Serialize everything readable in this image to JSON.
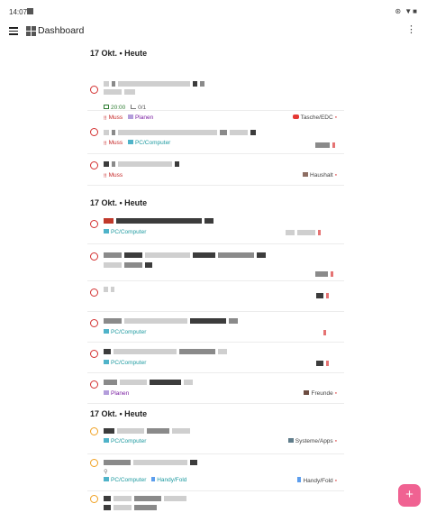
{
  "status_bar": {
    "time": "14:07",
    "icons": "⊛ ▼■"
  },
  "app_bar": {
    "title": "Dashboard",
    "more": "⋮"
  },
  "sections": [
    {
      "header": "17 Okt. • Heute",
      "tasks": [
        {
          "time": "20:00",
          "subtasks": "0/1",
          "prio": "Muss",
          "plan": "Planen",
          "right_tag": "Tasche/EDC"
        },
        {
          "prio": "Muss",
          "context": "PC/Computer"
        },
        {
          "prio": "Muss",
          "right_tag": "Haushalt"
        }
      ]
    },
    {
      "header": "17 Okt. • Heute",
      "tasks": [
        {
          "context": "PC/Computer"
        },
        {},
        {},
        {
          "context": "PC/Computer"
        },
        {
          "context": "PC/Computer"
        },
        {
          "plan": "Planen",
          "right_tag": "Freunde"
        }
      ]
    },
    {
      "header": "17 Okt. • Heute",
      "tasks": [
        {
          "context": "PC/Computer",
          "right_tag": "Systeme/Apps"
        },
        {
          "context": "PC/Computer",
          "context2": "Handy/Fold",
          "right_tag": "Handy/Fold"
        },
        {}
      ]
    }
  ],
  "fab": {
    "label": "+"
  },
  "colors": {
    "prio": "#c62828",
    "plan": "#7b1fa2",
    "context": "#1e9aa0",
    "time": "#2e7d32",
    "fab": "#f06292",
    "circle_red": "#d32f2f",
    "circle_orange": "#f0a020"
  },
  "icons": [
    "menu-icon",
    "dashboard-icon",
    "more-vert-icon",
    "calendar-icon",
    "subtask-icon",
    "exclamation-icon",
    "clipboard-icon",
    "computer-icon",
    "bag-icon",
    "house-icon",
    "people-icon",
    "phone-icon",
    "link-icon",
    "plus-icon"
  ]
}
